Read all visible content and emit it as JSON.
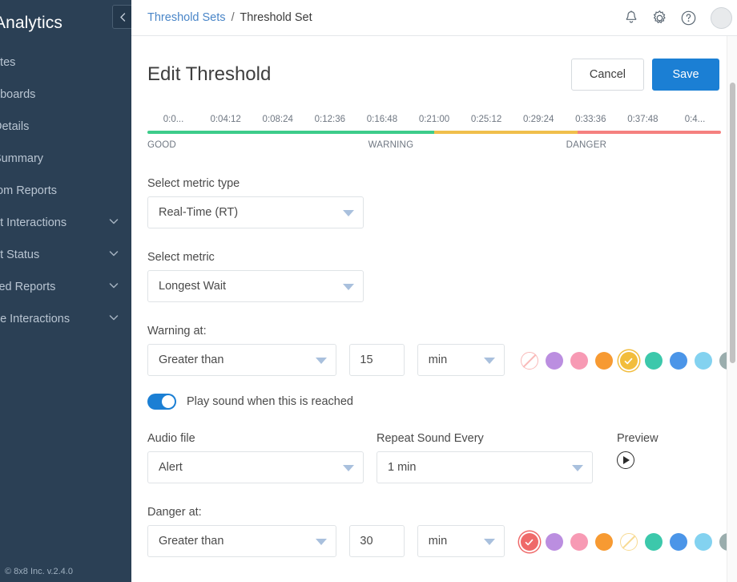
{
  "sidebar": {
    "brand": "Analytics",
    "collapse_icon": "chevron-left-icon",
    "items": [
      {
        "label": "rites",
        "expandable": false
      },
      {
        "label": "hboards",
        "expandable": false
      },
      {
        "label": "Details",
        "expandable": false
      },
      {
        "label": "Summary",
        "expandable": false
      },
      {
        "label": "tom Reports",
        "expandable": false
      },
      {
        "label": "nt Interactions",
        "expandable": true
      },
      {
        "label": "nt Status",
        "expandable": true
      },
      {
        "label": "iled Reports",
        "expandable": true
      },
      {
        "label": "ue Interactions",
        "expandable": true
      }
    ],
    "footer": "© 8x8 Inc. v.2.4.0"
  },
  "topbar": {
    "breadcrumb_parent": "Threshold Sets",
    "breadcrumb_separator": "/",
    "breadcrumb_current": "Threshold Set",
    "icons": [
      "bell-icon",
      "gear-icon",
      "help-icon",
      "avatar"
    ]
  },
  "page": {
    "title": "Edit Threshold",
    "cancel_label": "Cancel",
    "save_label": "Save"
  },
  "timeline": {
    "ticks": [
      "0:0...",
      "0:04:12",
      "0:08:24",
      "0:12:36",
      "0:16:48",
      "0:21:00",
      "0:25:12",
      "0:29:24",
      "0:33:36",
      "0:37:48",
      "0:4..."
    ],
    "segments": [
      {
        "name": "GOOD",
        "color": "#3dcc8a",
        "width_pct": 50.0
      },
      {
        "name": "WARNING",
        "color": "#f0bf4c",
        "width_pct": 25.0
      },
      {
        "name": "DANGER",
        "color": "#f5807f",
        "width_pct": 25.0
      }
    ],
    "zone_labels": [
      {
        "text": "GOOD",
        "left_pct": 0.0
      },
      {
        "text": "WARNING",
        "left_pct": 38.5
      },
      {
        "text": "DANGER",
        "left_pct": 73.0
      }
    ]
  },
  "form": {
    "metric_type_label": "Select metric type",
    "metric_type_value": "Real-Time (RT)",
    "metric_label": "Select metric",
    "metric_value": "Longest Wait",
    "warning": {
      "label": "Warning at:",
      "condition_value": "Greater than",
      "number_value": "15",
      "unit_value": "min",
      "swatches": [
        {
          "name": "red",
          "color": "#f5807f",
          "state": "disabled"
        },
        {
          "name": "purple",
          "color": "#bb8ee0",
          "state": "normal"
        },
        {
          "name": "pink",
          "color": "#f79ab4",
          "state": "normal"
        },
        {
          "name": "orange",
          "color": "#f79a32",
          "state": "normal"
        },
        {
          "name": "amber",
          "color": "#f2bd3c",
          "state": "selected"
        },
        {
          "name": "teal",
          "color": "#3cc8ab",
          "state": "normal"
        },
        {
          "name": "blue",
          "color": "#4b95e8",
          "state": "normal"
        },
        {
          "name": "sky",
          "color": "#83d2f0",
          "state": "normal"
        },
        {
          "name": "gray",
          "color": "#9aadad",
          "state": "normal"
        }
      ]
    },
    "sound": {
      "toggle_label": "Play sound when this is reached",
      "toggle_on": true,
      "audio_label": "Audio file",
      "audio_value": "Alert",
      "repeat_label": "Repeat Sound Every",
      "repeat_value": "1 min",
      "preview_label": "Preview",
      "preview_icon": "play-icon"
    },
    "danger": {
      "label": "Danger at:",
      "condition_value": "Greater than",
      "number_value": "30",
      "unit_value": "min",
      "swatches": [
        {
          "name": "red",
          "color": "#ef6a6a",
          "state": "selected"
        },
        {
          "name": "purple",
          "color": "#bb8ee0",
          "state": "normal"
        },
        {
          "name": "pink",
          "color": "#f79ab4",
          "state": "normal"
        },
        {
          "name": "orange",
          "color": "#f79a32",
          "state": "normal"
        },
        {
          "name": "amber",
          "color": "#f2bd3c",
          "state": "disabled"
        },
        {
          "name": "teal",
          "color": "#3cc8ab",
          "state": "normal"
        },
        {
          "name": "blue",
          "color": "#4b95e8",
          "state": "normal"
        },
        {
          "name": "sky",
          "color": "#83d2f0",
          "state": "normal"
        },
        {
          "name": "gray",
          "color": "#9aadad",
          "state": "normal"
        }
      ]
    }
  }
}
